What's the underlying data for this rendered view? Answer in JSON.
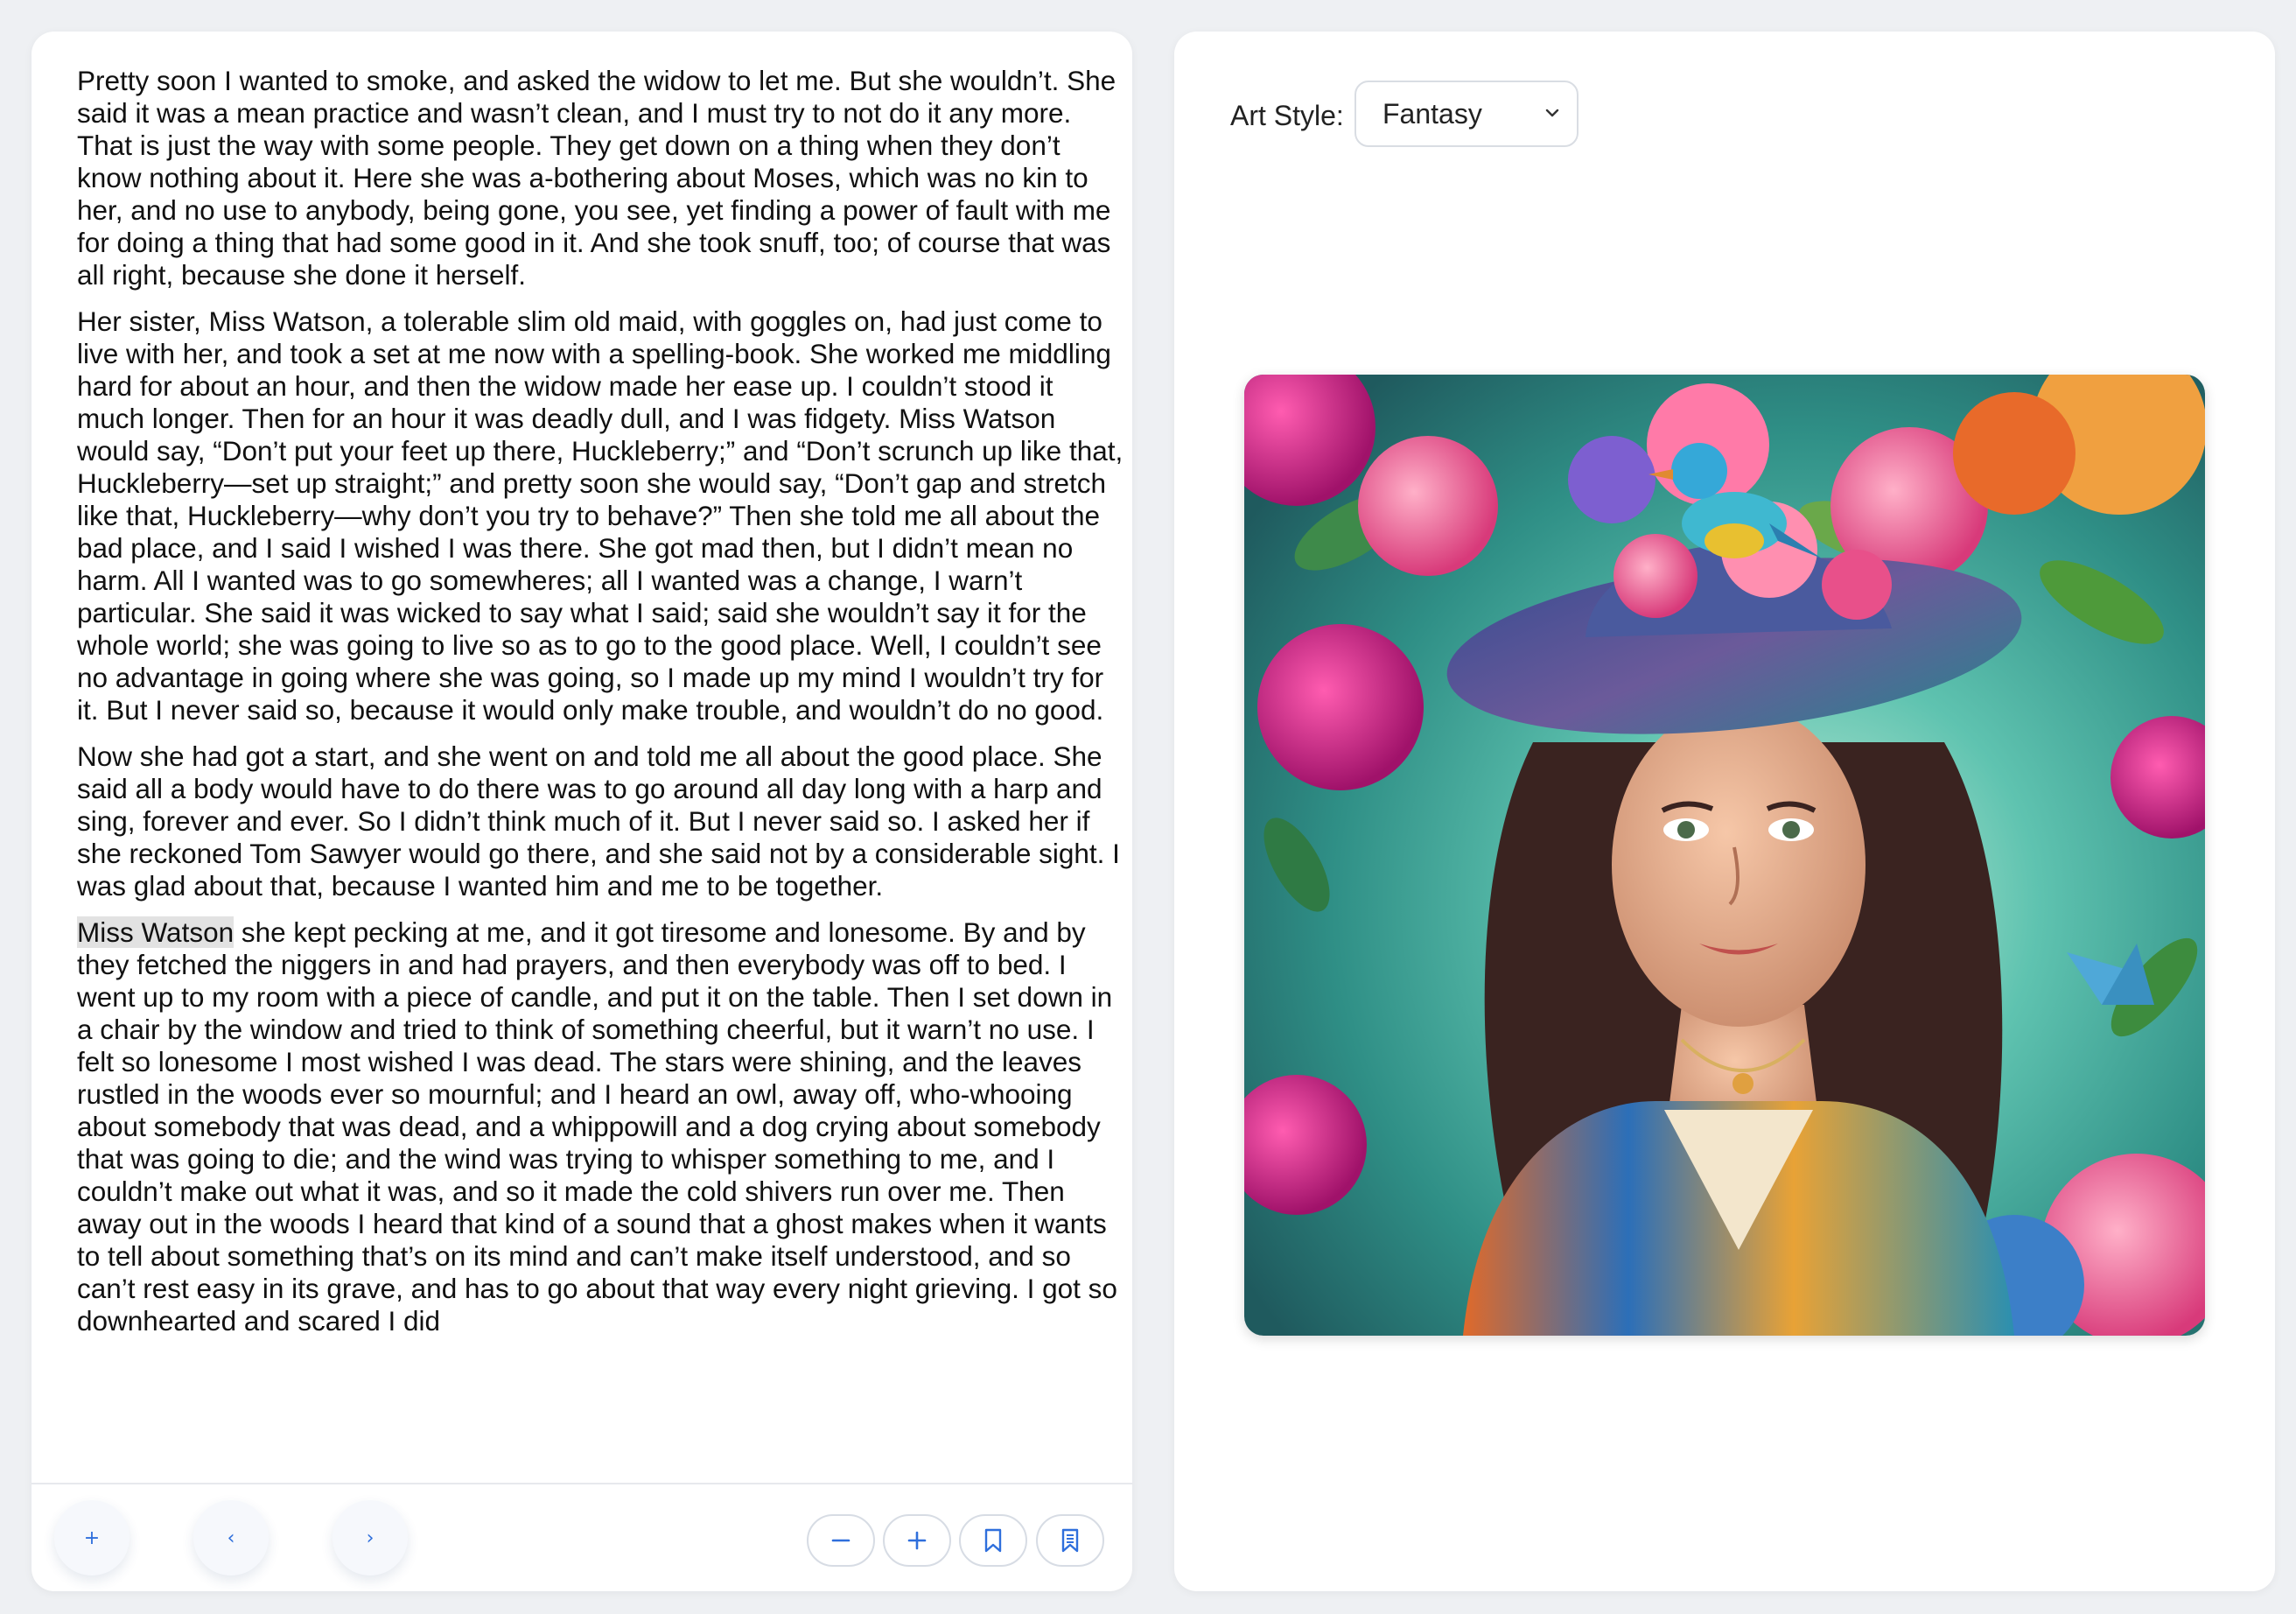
{
  "reader": {
    "paragraphs": [
      "Pretty soon I wanted to smoke, and asked the widow to let me. But she wouldn’t. She said it was a mean practice and wasn’t clean, and I must try to not do it any more. That is just the way with some people. They get down on a thing when they don’t know nothing about it. Here she was a-bothering about Moses, which was no kin to her, and no use to anybody, being gone, you see, yet finding a power of fault with me for doing a thing that had some good in it. And she took snuff, too; of course that was all right, because she done it herself.",
      "Her sister, Miss Watson, a tolerable slim old maid, with goggles on, had just come to live with her, and took a set at me now with a spelling-book. She worked me middling hard for about an hour, and then the widow made her ease up. I couldn’t stood it much longer. Then for an hour it was deadly dull, and I was fidgety. Miss Watson would say, “Don’t put your feet up there, Huckleberry;” and “Don’t scrunch up like that, Huckleberry—set up straight;” and pretty soon she would say, “Don’t gap and stretch like that, Huckleberry—why don’t you try to behave?” Then she told me all about the bad place, and I said I wished I was there. She got mad then, but I didn’t mean no harm. All I wanted was to go somewheres; all I wanted was a change, I warn’t particular. She said it was wicked to say what I said; said she wouldn’t say it for the whole world; she was going to live so as to go to the good place. Well, I couldn’t see no advantage in going where she was going, so I made up my mind I wouldn’t try for it. But I never said so, because it would only make trouble, and wouldn’t do no good.",
      "Now she had got a start, and she went on and told me all about the good place. She said all a body would have to do there was to go around all day long with a harp and sing, forever and ever. So I didn’t think much of it. But I never said so. I asked her if she reckoned Tom Sawyer would go there, and she said not by a considerable sight. I was glad about that, because I wanted him and me to be together."
    ],
    "last_paragraph_highlight": "Miss Watson",
    "last_paragraph_rest": " she kept pecking at me, and it got tiresome and lonesome. By and by they fetched the niggers in and had prayers, and then everybody was off to bed. I went up to my room with a piece of candle, and put it on the table. Then I set down in a chair by the window and tried to think of something cheerful, but it warn’t no use. I felt so lonesome I most wished I was dead. The stars were shining, and the leaves rustled in the woods ever so mournful; and I heard an owl, away off, who-whooing about somebody that was dead, and a whippowill and a dog crying about somebody that was going to die; and the wind was trying to whisper something to me, and I couldn’t make out what it was, and so it made the cold shivers run over me. Then away out in the woods I heard that kind of a sound that a ghost makes when it wants to tell about something that’s on its mind and can’t make itself understood, and so can’t rest easy in its grave, and has to go about that way every night grieving. I got so downhearted and scared I did"
  },
  "footer": {
    "add_label": "+",
    "prev_label": "‹",
    "next_label": "›",
    "tools": [
      "zoom-out-icon",
      "zoom-in-icon",
      "bookmark-icon",
      "bookmarks-list-icon"
    ]
  },
  "art": {
    "style_label": "Art Style:",
    "style_value": "Fantasy",
    "style_options": [
      "Fantasy"
    ]
  },
  "colors": {
    "accent": "#2f6fdc"
  }
}
